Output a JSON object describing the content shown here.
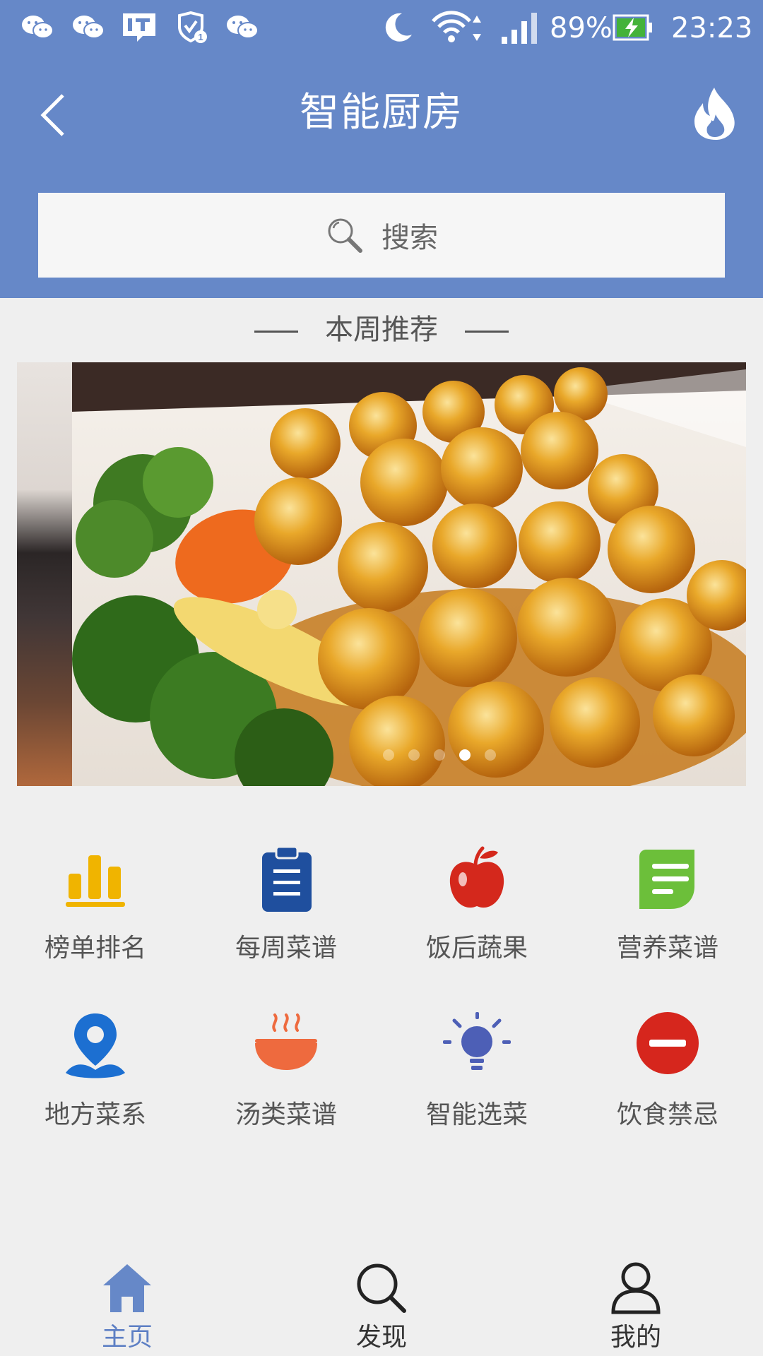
{
  "status_bar": {
    "battery": "89%",
    "time": "23:23",
    "notification_icons": [
      "wechat-icon",
      "wechat-icon",
      "it-news-icon",
      "shield-icon",
      "wechat-icon"
    ]
  },
  "header": {
    "title": "智能厨房"
  },
  "search": {
    "placeholder": "搜索"
  },
  "recommend": {
    "title": "本周推荐",
    "dots_count": 5,
    "active_dot": 4
  },
  "features": [
    {
      "label": "榜单排名",
      "icon": "bar-chart-icon",
      "color": "#f0b400"
    },
    {
      "label": "每周菜谱",
      "icon": "clipboard-icon",
      "color": "#1f4f9e"
    },
    {
      "label": "饭后蔬果",
      "icon": "apple-icon",
      "color": "#d4281c"
    },
    {
      "label": "营养菜谱",
      "icon": "note-icon",
      "color": "#6cbf3a"
    },
    {
      "label": "地方菜系",
      "icon": "location-pin-icon",
      "color": "#1c6fd1"
    },
    {
      "label": "汤类菜谱",
      "icon": "soup-bowl-icon",
      "color": "#ee6a3e"
    },
    {
      "label": "智能选菜",
      "icon": "lightbulb-icon",
      "color": "#4d5fb6"
    },
    {
      "label": "饮食禁忌",
      "icon": "no-entry-icon",
      "color": "#d6261d"
    }
  ],
  "tabbar": {
    "tabs": [
      {
        "label": "主页",
        "icon": "home-icon",
        "active": true
      },
      {
        "label": "发现",
        "icon": "search-icon",
        "active": false
      },
      {
        "label": "我的",
        "icon": "user-icon",
        "active": false
      }
    ]
  }
}
